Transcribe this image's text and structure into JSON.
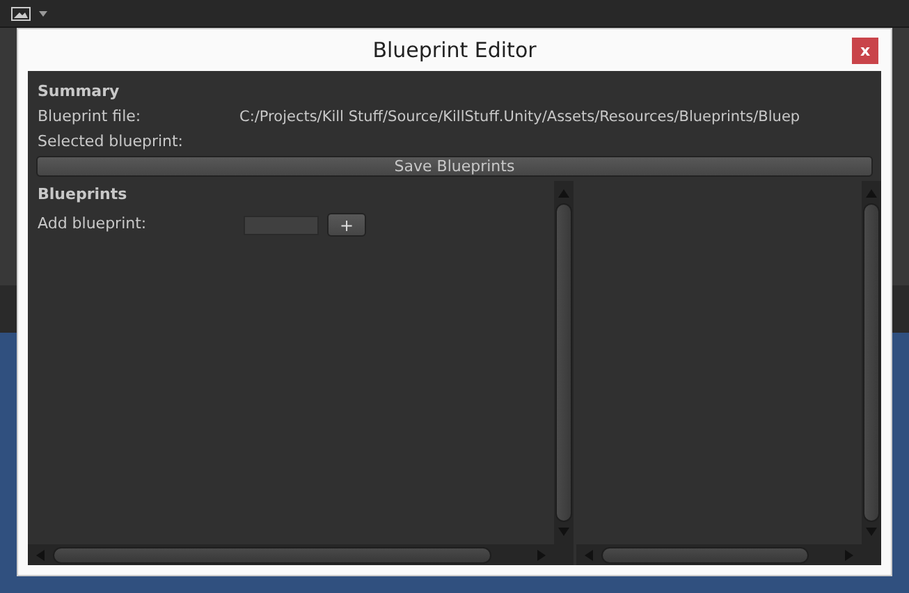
{
  "window": {
    "title": "Blueprint Editor",
    "close": "x"
  },
  "summary": {
    "heading": "Summary",
    "fields": [
      {
        "label": "Blueprint file:",
        "value": "C:/Projects/Kill Stuff/Source/KillStuff.Unity/Assets/Resources/Blueprints/Bluep"
      },
      {
        "label": "Selected blueprint:"
      }
    ],
    "save_button": "Save Blueprints"
  },
  "blueprints": {
    "heading": "Blueprints",
    "add_label": "Add blueprint:",
    "add_button": "+"
  }
}
